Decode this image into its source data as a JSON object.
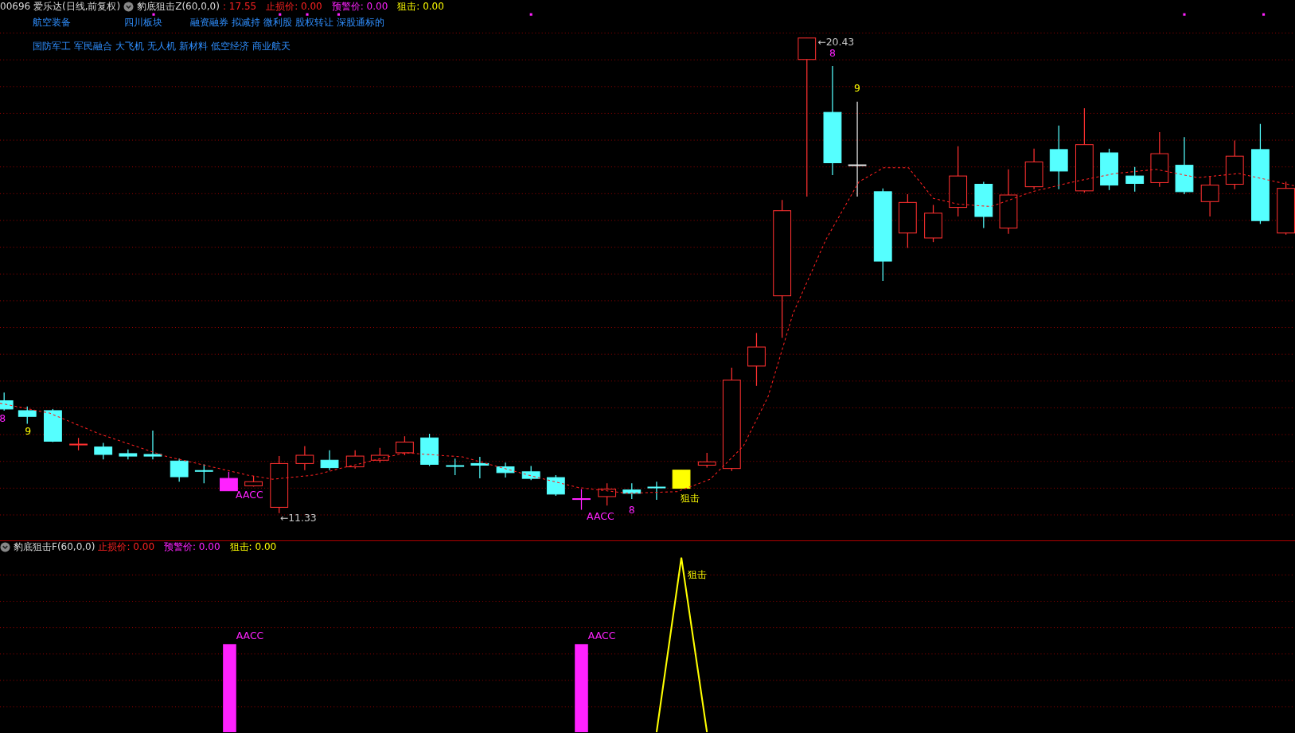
{
  "main_header": {
    "title": "00696 爱乐达(日线,前复权)",
    "indicator": "豹底狙击Z(60,0,0)",
    "price": ": 17.55",
    "values": [
      {
        "text": "止损价: 0.00",
        "color": "#ff2222"
      },
      {
        "text": "预警价: 0.00",
        "color": "#ff22ff"
      },
      {
        "text": "狙击: 0.00",
        "color": "#ffff00"
      }
    ]
  },
  "tag_rows": [
    [
      [
        "航空装备"
      ],
      [
        "四川板块"
      ],
      [
        "融资融券",
        "拟减持",
        "微利股",
        "股权转让",
        "深股通标的"
      ]
    ],
    [
      [
        "国防军工",
        "军民融合",
        "大飞机",
        "无人机",
        "新材料",
        "低空经济",
        "商业航天"
      ]
    ]
  ],
  "chart_labels": [
    {
      "text": "←20.43",
      "color": "#c8c8c8"
    },
    {
      "text": "8",
      "color": "#ff22ff"
    },
    {
      "text": "9",
      "color": "#ffff00"
    },
    {
      "text": "8",
      "color": "#ff22ff"
    },
    {
      "text": "9",
      "color": "#ffff00"
    },
    {
      "text": "AACC",
      "color": "#ff22ff"
    },
    {
      "text": "←11.33",
      "color": "#c8c8c8"
    },
    {
      "text": "AACC",
      "color": "#ff22ff"
    },
    {
      "text": "8",
      "color": "#ff22ff"
    },
    {
      "text": "狙击",
      "color": "#ffff00"
    }
  ],
  "sub_header": {
    "indicator": "豹底狙击F(60,0,0)",
    "values": [
      {
        "text": "止损价: 0.00",
        "color": "#ff2222"
      },
      {
        "text": "预警价: 0.00",
        "color": "#ff22ff"
      },
      {
        "text": "狙击: 0.00",
        "color": "#ffff00"
      }
    ]
  },
  "sub_labels": [
    {
      "text": "AACC",
      "color": "#ff22ff"
    },
    {
      "text": "AACC",
      "color": "#ff22ff"
    },
    {
      "text": "狙击",
      "color": "#ffff00"
    }
  ]
}
